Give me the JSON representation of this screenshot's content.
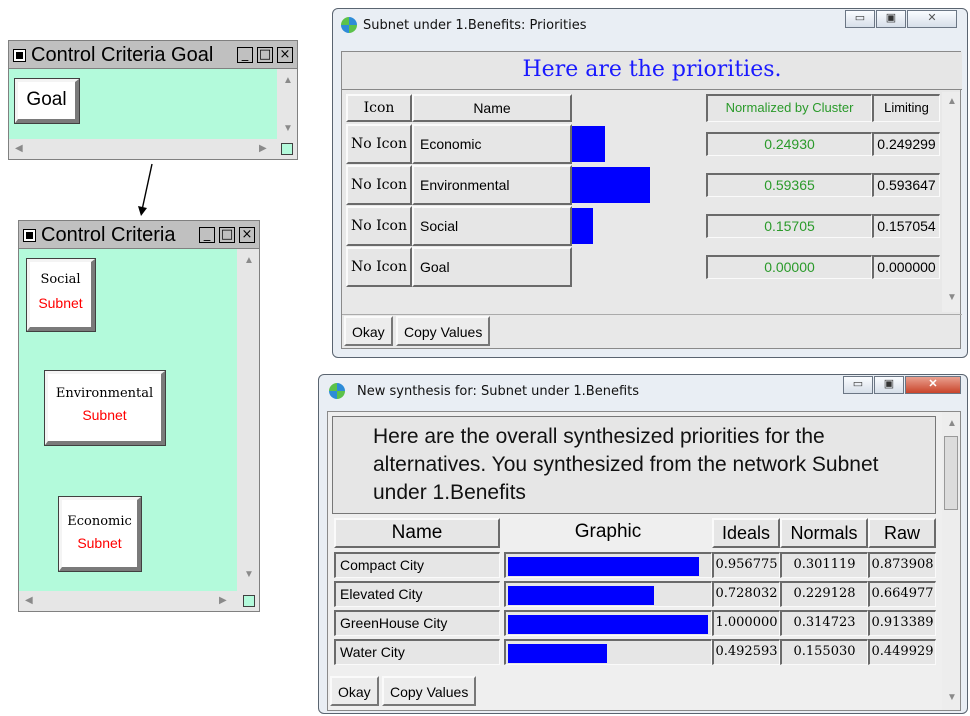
{
  "goal_window": {
    "title": "Control Criteria Goal",
    "node": "Goal",
    "min": "_",
    "max": "□",
    "close": "×"
  },
  "cc_window": {
    "title": "Control Criteria",
    "min": "_",
    "max": "□",
    "close": "×",
    "nodes": [
      {
        "name": "Social",
        "sub": "Subnet"
      },
      {
        "name": "Environmental",
        "sub": "Subnet"
      },
      {
        "name": "Economic",
        "sub": "Subnet"
      }
    ]
  },
  "priorities_window": {
    "title": "Subnet under 1.Benefits: Priorities",
    "heading": "Here are the priorities.",
    "columns": {
      "icon": "Icon",
      "name": "Name",
      "normalized": "Normalized by Cluster",
      "limiting": "Limiting"
    },
    "rows": [
      {
        "icon": "No Icon",
        "name": "Economic",
        "normalized": "0.24930",
        "limiting": "0.249299",
        "value": 0.2493
      },
      {
        "icon": "No Icon",
        "name": "Environmental",
        "normalized": "0.59365",
        "limiting": "0.593647",
        "value": 0.59365
      },
      {
        "icon": "No Icon",
        "name": "Social",
        "normalized": "0.15705",
        "limiting": "0.157054",
        "value": 0.15705
      },
      {
        "icon": "No Icon",
        "name": "Goal",
        "normalized": "0.00000",
        "limiting": "0.000000",
        "value": 0.0
      }
    ],
    "okay": "Okay",
    "copy": "Copy Values"
  },
  "synthesis_window": {
    "title": "New synthesis for: Subnet under 1.Benefits",
    "heading": "Here are the overall synthesized priorities for the alternatives.  You synthesized from the network Subnet under 1.Benefits",
    "columns": {
      "name": "Name",
      "graphic": "Graphic",
      "ideals": "Ideals",
      "normals": "Normals",
      "raw": "Raw"
    },
    "rows": [
      {
        "name": "Compact City",
        "ideals": "0.956775",
        "normals": "0.301119",
        "raw": "0.873908",
        "value": 0.956775
      },
      {
        "name": "Elevated City",
        "ideals": "0.728032",
        "normals": "0.229128",
        "raw": "0.664977",
        "value": 0.728032
      },
      {
        "name": "GreenHouse City",
        "ideals": "1.000000",
        "normals": "0.314723",
        "raw": "0.913389",
        "value": 1.0
      },
      {
        "name": "Water City",
        "ideals": "0.492593",
        "normals": "0.155030",
        "raw": "0.449929",
        "value": 0.492593
      }
    ],
    "okay": "Okay",
    "copy": "Copy Values"
  },
  "colors": {
    "bar": "#0000ff",
    "green_text": "#2a9a2a",
    "heading_blue": "#1a1aff",
    "subnet_red": "#ff0000",
    "canvas": "#b3fadb"
  }
}
